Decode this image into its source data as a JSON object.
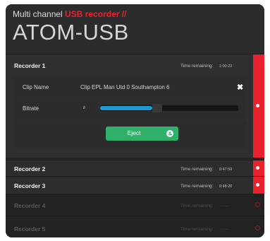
{
  "header": {
    "subtitle": "Multi channel ",
    "subtitle_accent": "USB recorder //",
    "title": "ATOM-USB"
  },
  "recorders": [
    {
      "name": "Recorder 1",
      "time_label": "Time remaining:",
      "time_value": "1:00:22",
      "expanded": true,
      "clip_name_label": "Clip Name",
      "clip_name_value": "Clip EPL Man Utd 0 Southampton 6",
      "bitrate_label": "Bitrate",
      "bitrate_value": "8",
      "bitrate_fraction": 0.38,
      "eject_label": "Eject"
    },
    {
      "name": "Recorder 2",
      "time_label": "Time remaining:",
      "time_value": "0:47:59"
    },
    {
      "name": "Recorder 3",
      "time_label": "Time remaining:",
      "time_value": "0:48:20"
    },
    {
      "name": "Recorder 4",
      "time_label": "Time remaining:",
      "time_value": "-:--:--",
      "inactive": true
    },
    {
      "name": "Recorder 5",
      "time_label": "Time remaining:",
      "time_value": "-:--:--",
      "inactive": true
    }
  ],
  "colors": {
    "accent": "#e8232e",
    "eject": "#2fb16a",
    "slider": "#1e9ad6"
  },
  "icons": {
    "clear": "close-icon",
    "eject": "eject-icon"
  }
}
